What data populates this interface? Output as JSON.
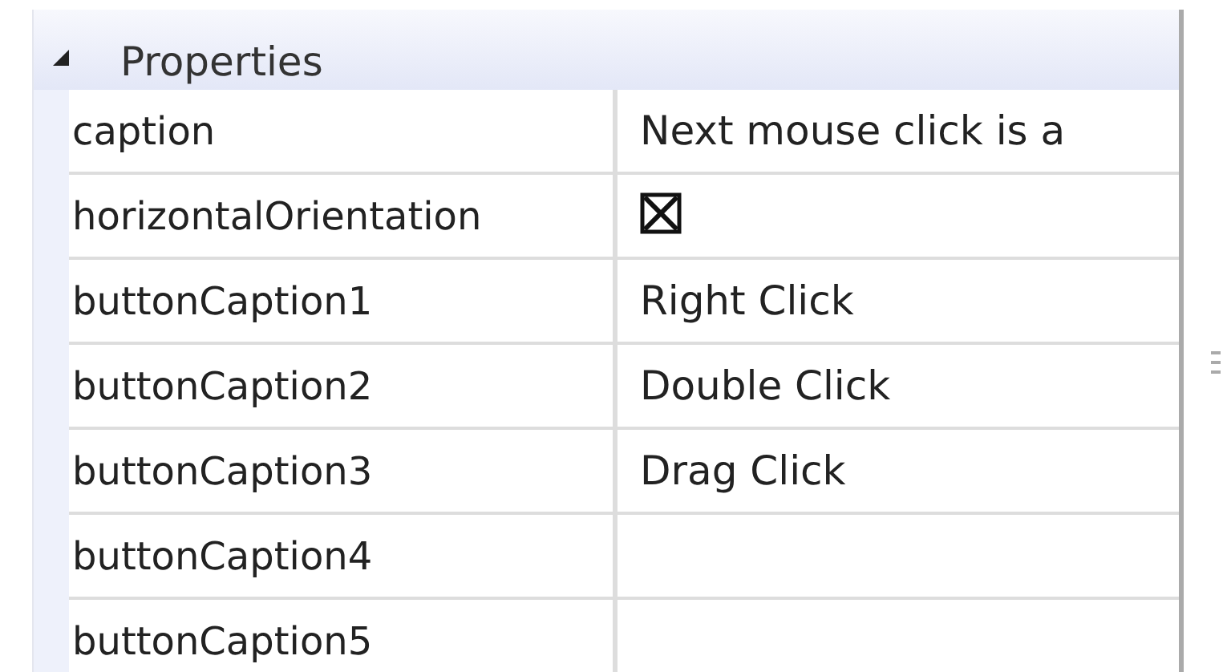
{
  "category": {
    "label": "Properties",
    "expanded": true
  },
  "properties": [
    {
      "name": "caption",
      "kind": "text",
      "value": "Next mouse click is a"
    },
    {
      "name": "horizontalOrientation",
      "kind": "checkbox",
      "checked": true
    },
    {
      "name": "buttonCaption1",
      "kind": "text",
      "value": "Right Click"
    },
    {
      "name": "buttonCaption2",
      "kind": "text",
      "value": "Double Click"
    },
    {
      "name": "buttonCaption3",
      "kind": "text",
      "value": "Drag Click"
    },
    {
      "name": "buttonCaption4",
      "kind": "text"
    },
    {
      "name": "buttonCaption5",
      "kind": "text"
    }
  ]
}
